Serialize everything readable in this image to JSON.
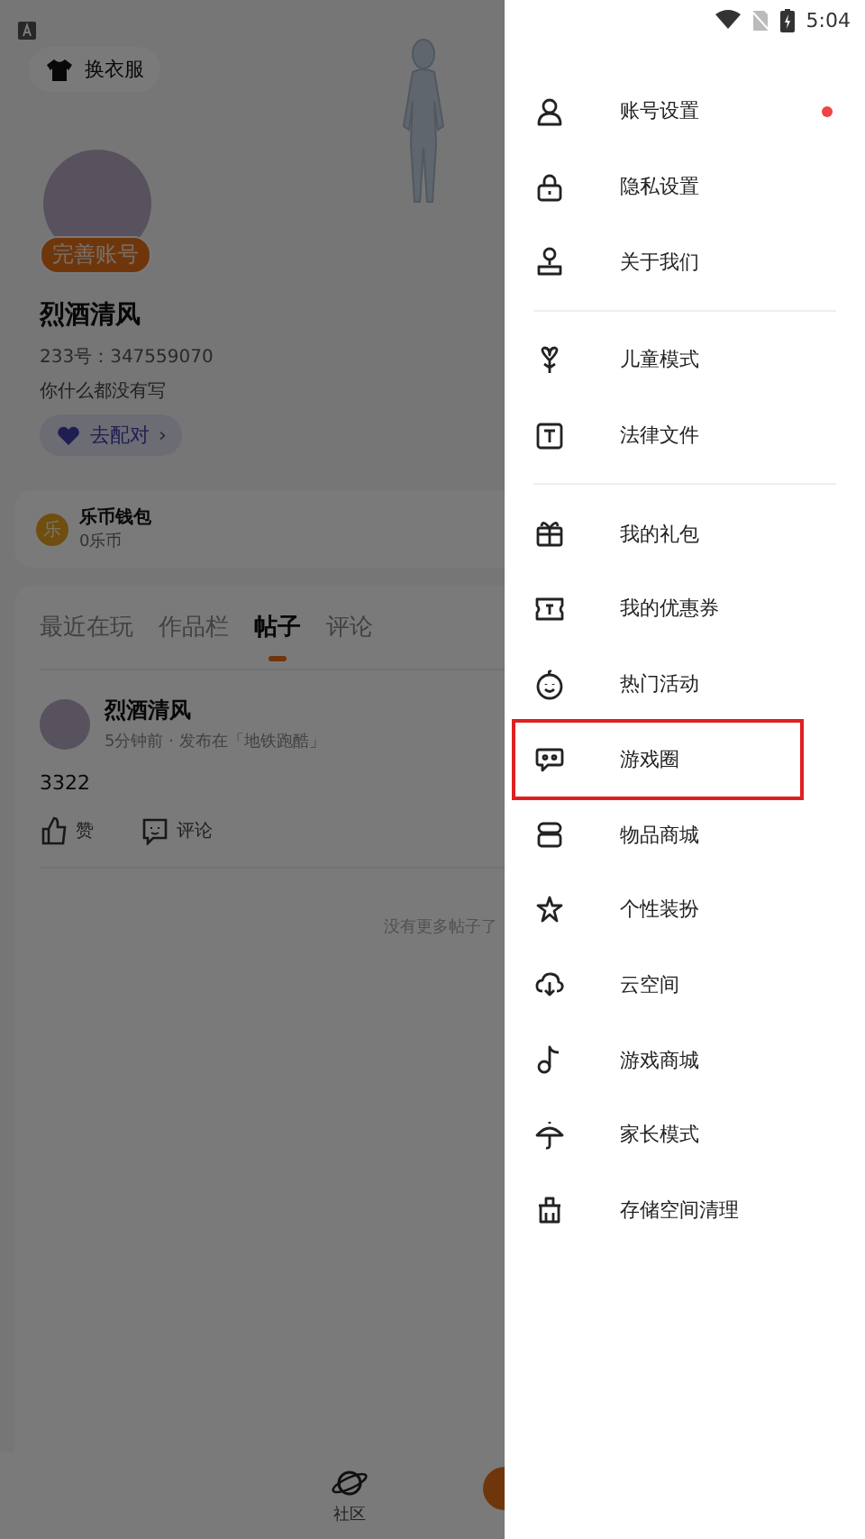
{
  "status_bar": {
    "time": "5:04"
  },
  "profile": {
    "outfit_button": "换衣服",
    "badge": "完善账号",
    "name": "烈酒清风",
    "id_line": "233号：347559070",
    "bio": "你什么都没有写",
    "match_button": "去配对",
    "match_chevron": "›"
  },
  "wallet": {
    "coin_label": "乐",
    "title": "乐币钱包",
    "balance": "0乐币"
  },
  "tabs": [
    {
      "label": "最近在玩",
      "selected": false
    },
    {
      "label": "作品栏",
      "selected": false
    },
    {
      "label": "帖子",
      "selected": true
    },
    {
      "label": "评论",
      "selected": false
    }
  ],
  "post": {
    "author": "烈酒清风",
    "meta": "5分钟前 · 发布在「地铁跑酷」",
    "body": "3322",
    "like": "赞",
    "comment": "评论"
  },
  "end_note": "没有更多帖子了",
  "bottom_nav": [
    {
      "label": "社区"
    }
  ],
  "drawer": {
    "groups": [
      [
        {
          "label": "账号设置",
          "badge": true,
          "highlighted": false
        },
        {
          "label": "隐私设置",
          "badge": false,
          "highlighted": false
        },
        {
          "label": "关于我们",
          "badge": false,
          "highlighted": false
        }
      ],
      [
        {
          "label": "儿童模式",
          "badge": false,
          "highlighted": false
        },
        {
          "label": "法律文件",
          "badge": false,
          "highlighted": false
        }
      ],
      [
        {
          "label": "我的礼包",
          "badge": false,
          "highlighted": false
        },
        {
          "label": "我的优惠券",
          "badge": false,
          "highlighted": false
        },
        {
          "label": "热门活动",
          "badge": false,
          "highlighted": false
        },
        {
          "label": "游戏圈",
          "badge": false,
          "highlighted": true
        },
        {
          "label": "物品商城",
          "badge": false,
          "highlighted": false
        },
        {
          "label": "个性装扮",
          "badge": false,
          "highlighted": false
        },
        {
          "label": "云空间",
          "badge": false,
          "highlighted": false
        },
        {
          "label": "游戏商城",
          "badge": false,
          "highlighted": false
        },
        {
          "label": "家长模式",
          "badge": false,
          "highlighted": false
        },
        {
          "label": "存储空间清理",
          "badge": false,
          "highlighted": false
        }
      ]
    ]
  }
}
